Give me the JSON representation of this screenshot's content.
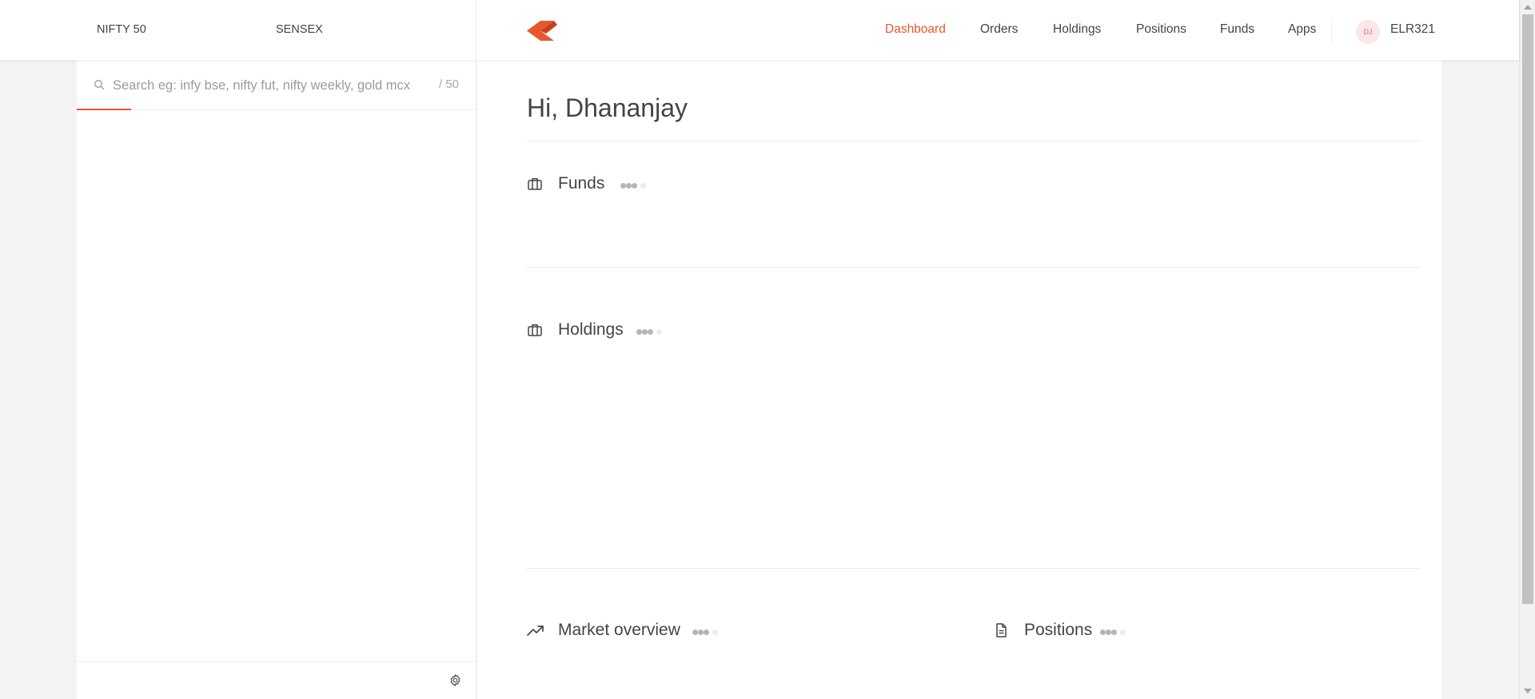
{
  "header": {
    "indices": [
      {
        "name": "NIFTY 50"
      },
      {
        "name": "SENSEX"
      }
    ],
    "logo_color": "#e8572a",
    "nav": [
      {
        "label": "Dashboard",
        "active": true
      },
      {
        "label": "Orders",
        "active": false
      },
      {
        "label": "Holdings",
        "active": false
      },
      {
        "label": "Positions",
        "active": false
      },
      {
        "label": "Funds",
        "active": false
      },
      {
        "label": "Apps",
        "active": false
      }
    ],
    "user": {
      "avatar_initials": "DJ",
      "user_id": "ELR321"
    }
  },
  "sidebar": {
    "search": {
      "placeholder": "Search eg: infy bse, nifty fut, nifty weekly, gold mcx",
      "value": "",
      "count": "/ 50",
      "icon": "search-icon"
    },
    "footer": {
      "icon": "settings-icon"
    }
  },
  "main": {
    "greeting": "Hi, Dhananjay",
    "sections": {
      "funds": {
        "title": "Funds",
        "icon": "briefcase-icon"
      },
      "holdings": {
        "title": "Holdings",
        "icon": "briefcase-icon"
      },
      "market_overview": {
        "title": "Market overview",
        "icon": "trending-up-icon"
      },
      "positions": {
        "title": "Positions",
        "icon": "document-icon"
      }
    }
  },
  "colors": {
    "accent": "#e8572a",
    "text": "#444444",
    "loader_dot": "#b5b5b5"
  }
}
